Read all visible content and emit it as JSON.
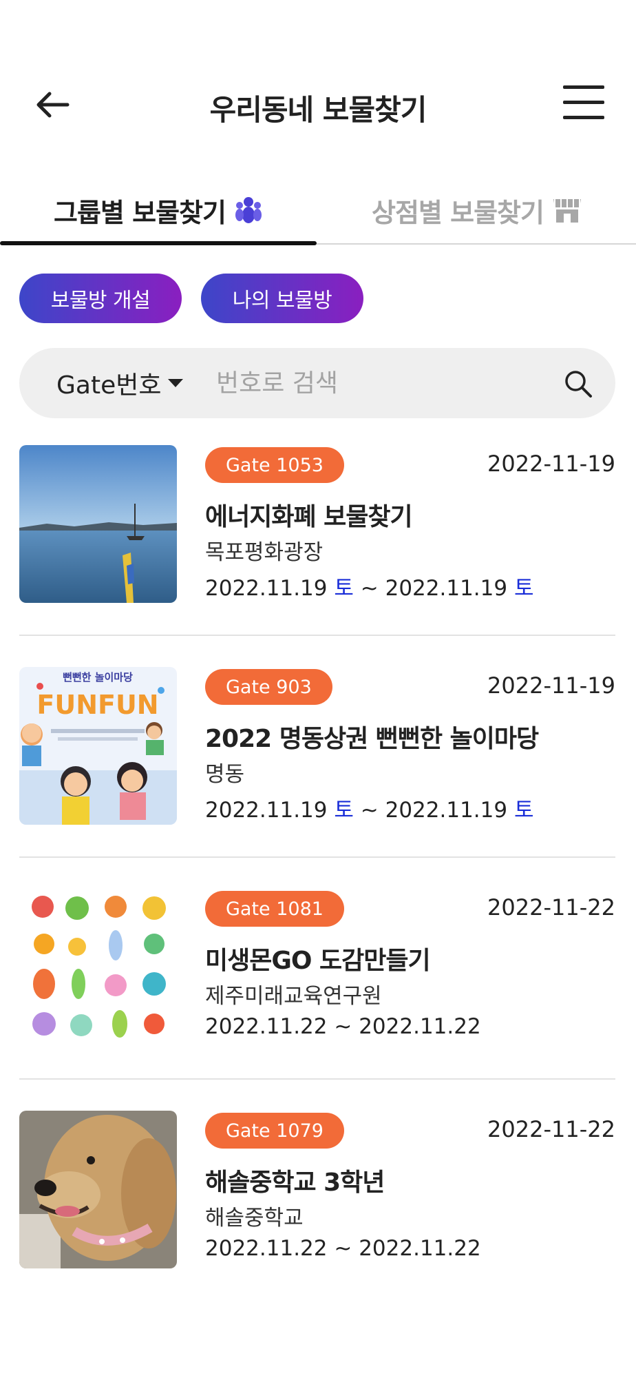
{
  "header": {
    "title": "우리동네 보물찾기",
    "back_icon": "arrow-left-icon",
    "menu_icon": "hamburger-menu-icon"
  },
  "tabs": [
    {
      "label": "그룹별 보물찾기",
      "icon": "group-people-icon",
      "active": true
    },
    {
      "label": "상점별 보물찾기",
      "icon": "storefront-icon",
      "active": false
    }
  ],
  "actions": {
    "open_room": "보물방 개설",
    "my_room": "나의 보물방"
  },
  "search": {
    "filter_label": "Gate번호",
    "placeholder": "번호로 검색",
    "icon": "search-icon"
  },
  "colors": {
    "badge": "#f26b38",
    "pill_gradient_start": "#3d46c9",
    "pill_gradient_end": "#8a1fc0",
    "weekday": "#1a2ed8"
  },
  "items": [
    {
      "gate": "Gate 1053",
      "date": "2022-11-19",
      "name": "에너지화폐 보물찾기",
      "place": "목포평화광장",
      "start": "2022.11.19",
      "start_day": "토",
      "end": "2022.11.19",
      "end_day": "토",
      "thumb": "seaside-photo"
    },
    {
      "gate": "Gate 903",
      "date": "2022-11-19",
      "name": "2022 명동상권 뻔뻔한 놀이마당",
      "place": "명동",
      "start": "2022.11.19",
      "start_day": "토",
      "end": "2022.11.19",
      "end_day": "토",
      "thumb": "festival-poster",
      "poster_text": "뻔뻔한 놀이마당",
      "poster_title": "FUNFUN"
    },
    {
      "gate": "Gate 1081",
      "date": "2022-11-22",
      "name": "미생몬GO 도감만들기",
      "place": "제주미래교육연구원",
      "start": "2022.11.22",
      "start_day": "",
      "end": "2022.11.22",
      "end_day": "",
      "thumb": "microbe-characters"
    },
    {
      "gate": "Gate 1079",
      "date": "2022-11-22",
      "name": "해솔중학교 3학년",
      "place": "해솔중학교",
      "start": "2022.11.22",
      "start_day": "",
      "end": "2022.11.22",
      "end_day": "",
      "thumb": "dog-photo"
    }
  ]
}
